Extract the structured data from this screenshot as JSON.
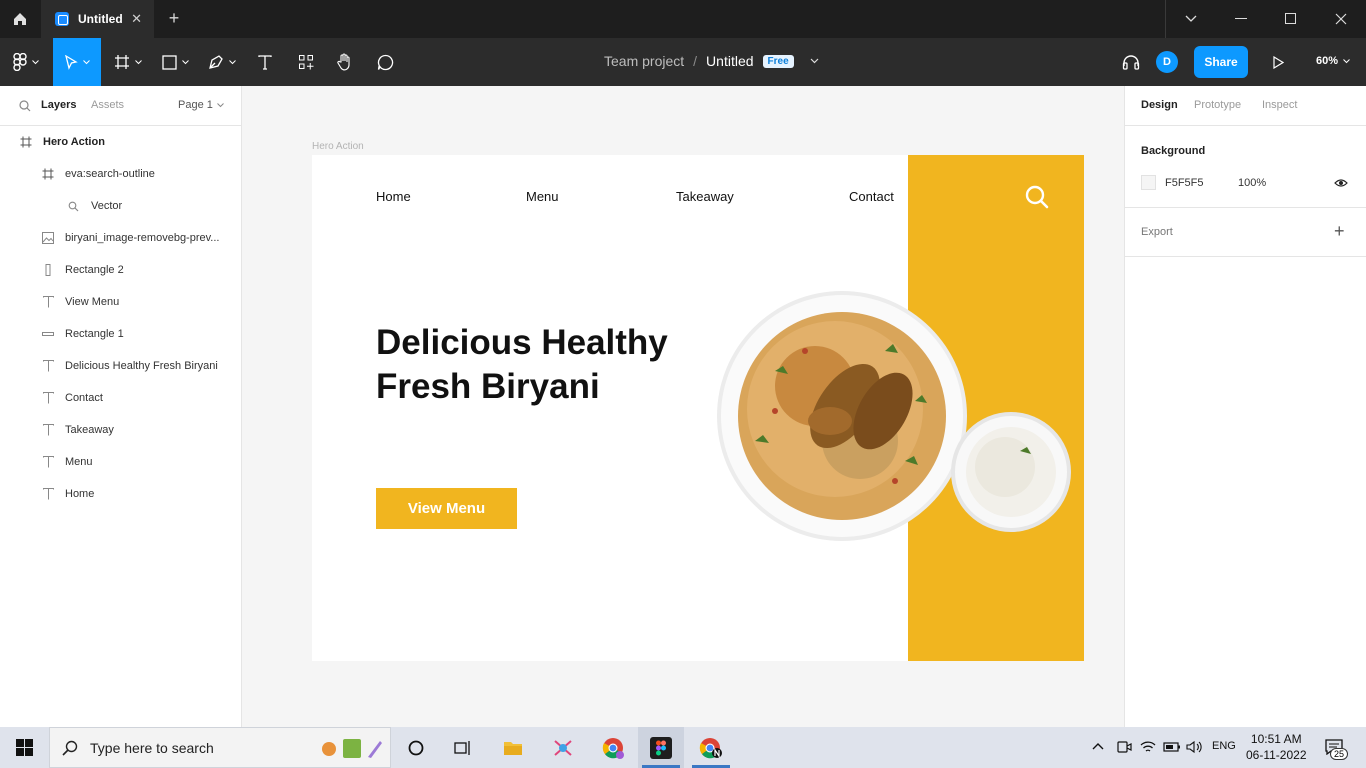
{
  "titlebar": {
    "tab_title": "Untitled",
    "tab_close": "✕",
    "new_tab": "+"
  },
  "toolbar": {
    "team": "Team project",
    "slash": "/",
    "file": "Untitled",
    "badge": "Free",
    "avatar": "D",
    "share": "Share",
    "zoom": "60%"
  },
  "left_panel": {
    "tab_layers": "Layers",
    "tab_assets": "Assets",
    "page": "Page 1",
    "layers": [
      {
        "label": "Hero Action",
        "icon": "frame-icon",
        "indent": 0
      },
      {
        "label": "eva:search-outline",
        "icon": "frame-icon",
        "indent": 1
      },
      {
        "label": "Vector",
        "icon": "search-icon",
        "indent": 2
      },
      {
        "label": "biryani_image-removebg-prev...",
        "icon": "image-icon",
        "indent": 1
      },
      {
        "label": "Rectangle 2",
        "icon": "rectangle-vertical-icon",
        "indent": 1
      },
      {
        "label": "View Menu",
        "icon": "text-icon",
        "indent": 1
      },
      {
        "label": "Rectangle 1",
        "icon": "rectangle-horizontal-icon",
        "indent": 1
      },
      {
        "label": "Delicious Healthy Fresh Biryani",
        "icon": "text-icon",
        "indent": 1
      },
      {
        "label": "Contact",
        "icon": "text-icon",
        "indent": 1
      },
      {
        "label": "Takeaway",
        "icon": "text-icon",
        "indent": 1
      },
      {
        "label": "Menu",
        "icon": "text-icon",
        "indent": 1
      },
      {
        "label": "Home",
        "icon": "text-icon",
        "indent": 1
      }
    ]
  },
  "canvas": {
    "frame_label": "Hero Action",
    "nav": [
      "Home",
      "Menu",
      "Takeaway",
      "Contact"
    ],
    "headline_line1": "Delicious Healthy",
    "headline_line2": "Fresh Biryani",
    "cta": "View Menu",
    "accent_color": "#F1B51F",
    "help": "?"
  },
  "right_panel": {
    "tab_design": "Design",
    "tab_prototype": "Prototype",
    "tab_inspect": "Inspect",
    "background_title": "Background",
    "background_hex": "F5F5F5",
    "background_opacity": "100%",
    "export_title": "Export",
    "export_add": "+"
  },
  "taskbar": {
    "search_placeholder": "Type here to search",
    "lang": "ENG",
    "time": "10:51 AM",
    "date": "06-11-2022",
    "notif_count": "25"
  }
}
